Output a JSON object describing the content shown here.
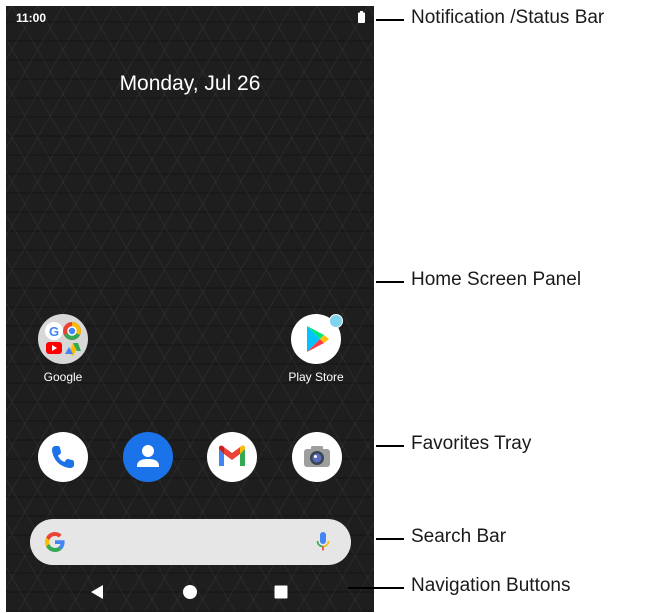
{
  "status_bar": {
    "time": "11:00",
    "battery_icon": "battery-full-icon"
  },
  "home": {
    "date": "Monday, Jul 26",
    "apps": [
      {
        "label": "Google",
        "icon": "google-folder-icon"
      },
      {
        "label": "Play Store",
        "icon": "play-store-icon"
      }
    ],
    "favorites": [
      {
        "icon": "phone-icon"
      },
      {
        "icon": "contacts-icon"
      },
      {
        "icon": "gmail-icon"
      },
      {
        "icon": "camera-icon"
      }
    ]
  },
  "search_bar": {
    "logo_icon": "google-g-icon",
    "mic_icon": "mic-icon"
  },
  "navigation": {
    "back_icon": "back-triangle-icon",
    "home_icon": "home-circle-icon",
    "recents_icon": "recents-square-icon"
  },
  "callouts": [
    {
      "label": "Notification /Status Bar"
    },
    {
      "label": "Home Screen Panel"
    },
    {
      "label": "Favorites Tray"
    },
    {
      "label": "Search Bar"
    },
    {
      "label": "Navigation Buttons"
    }
  ],
  "colors": {
    "wallpaper": "#1e1e1e",
    "google_blue": "#4285F4",
    "google_red": "#EA4335",
    "google_yellow": "#FBBC05",
    "google_green": "#34A853",
    "contacts_blue": "#1a73e8",
    "notification_dot": "#7fd3ee"
  }
}
